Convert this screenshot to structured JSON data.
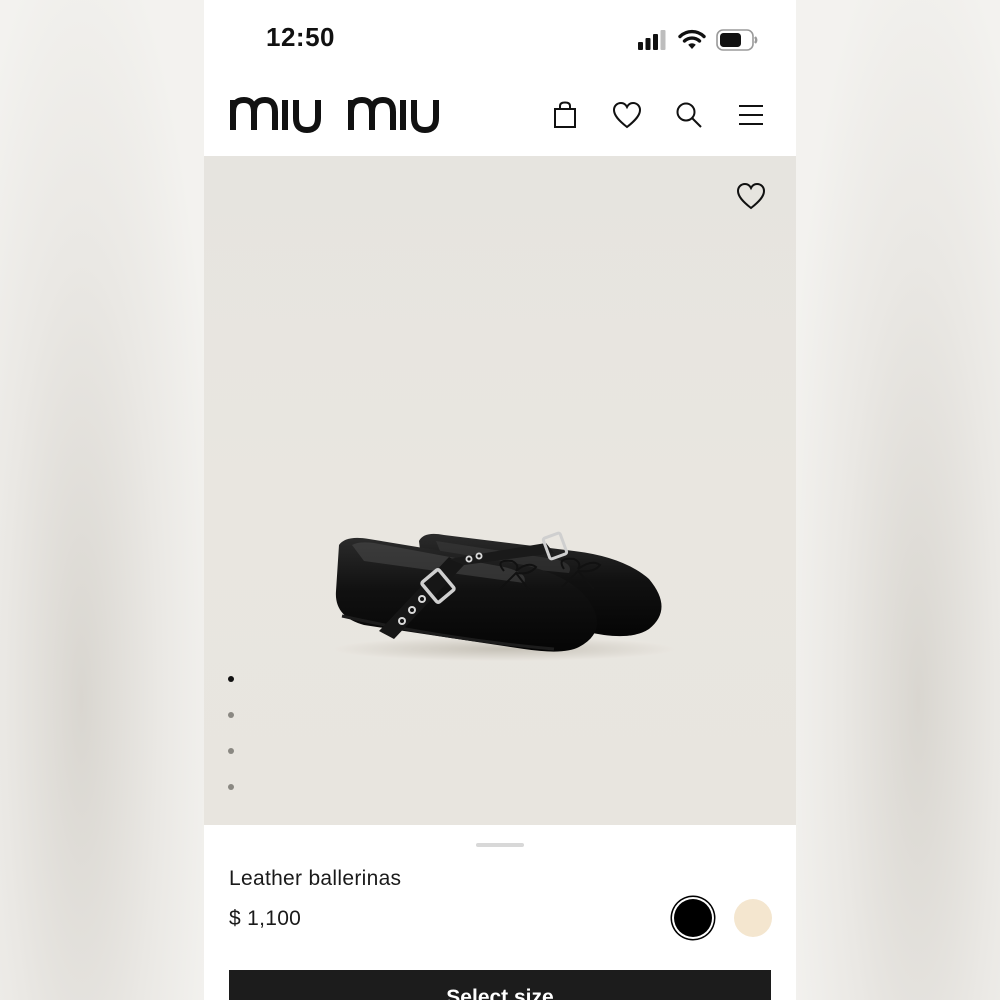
{
  "status_bar": {
    "time": "12:50"
  },
  "header": {
    "brand": "miu miu",
    "icons": [
      "shopping-bag-icon",
      "heart-icon",
      "search-icon",
      "menu-icon"
    ]
  },
  "gallery": {
    "image": "black leather ballerinas with buckle strap",
    "dot_count": 4,
    "active_dot": 1
  },
  "product": {
    "name": "Leather ballerinas",
    "price": "$ 1,100",
    "colors": [
      {
        "name": "black",
        "hex": "#000000",
        "selected": true
      },
      {
        "name": "cream",
        "hex": "#f4e6cf",
        "selected": false
      }
    ],
    "cta_label": "Select size"
  }
}
